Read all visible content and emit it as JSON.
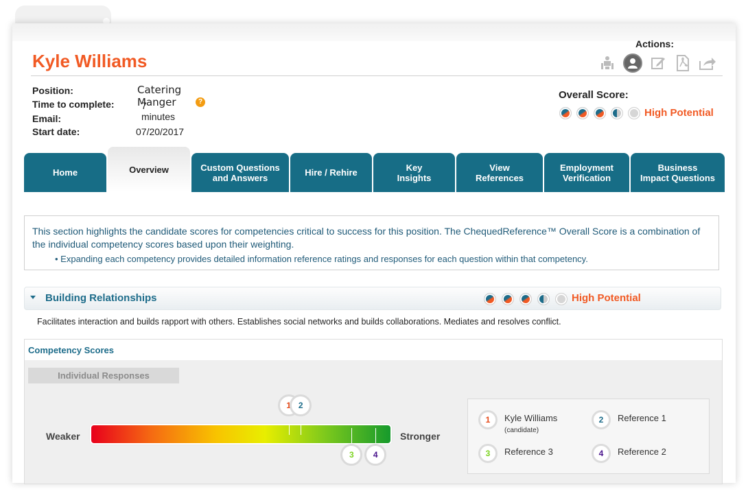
{
  "candidate": {
    "name": "Kyle Williams"
  },
  "actions": {
    "label": "Actions:",
    "icons": [
      "interview-icon",
      "user-profile-icon",
      "edit-icon",
      "pdf-icon",
      "share-icon"
    ]
  },
  "details": {
    "position_label": "Position:",
    "position_value": "Catering Manger",
    "time_label": "Time to complete:",
    "time_value": "7 minutes",
    "help_glyph": "?",
    "email_label": "Email:",
    "email_value": "",
    "start_label": "Start date:",
    "start_value": "07/20/2017"
  },
  "overall": {
    "label": "Overall Score:",
    "rating": "High Potential",
    "score_of_5": 3.5
  },
  "tabs": [
    {
      "line1": "Home",
      "line2": ""
    },
    {
      "line1": "Overview",
      "line2": ""
    },
    {
      "line1": "Custom Questions",
      "line2": "and Answers"
    },
    {
      "line1": "Hire / Rehire",
      "line2": ""
    },
    {
      "line1": "Key",
      "line2": "Insights"
    },
    {
      "line1": "View",
      "line2": "References"
    },
    {
      "line1": "Employment",
      "line2": "Verification"
    },
    {
      "line1": "Business",
      "line2": "Impact Questions"
    }
  ],
  "active_tab": "Overview",
  "intro": {
    "text": "This section highlights the candidate scores for competencies critical to success for this position. The ChequedReference™ Overall Score is a combination of the individual competency scores based upon their weighting.",
    "bullet": "• Expanding each competency provides detailed information reference ratings and responses for each question within that competency."
  },
  "competency": {
    "title": "Building Relationships",
    "rating": "High Potential",
    "score_of_5": 3.5,
    "description": "Facilitates interaction and builds rapport with others. Establishes social networks and builds collaborations. Mediates and resolves conflict."
  },
  "scores": {
    "title": "Competency Scores",
    "individual_responses_label": "Individual Responses",
    "weaker_label": "Weaker",
    "stronger_label": "Stronger",
    "markers": [
      {
        "num": "1",
        "scale_fraction": 0.66
      },
      {
        "num": "2",
        "scale_fraction": 0.7
      },
      {
        "num": "3",
        "scale_fraction": 0.87
      },
      {
        "num": "4",
        "scale_fraction": 0.95
      }
    ],
    "legend": [
      {
        "num": "1",
        "name": "Kyle Williams",
        "sub": "(candidate)"
      },
      {
        "num": "2",
        "name": "Reference 1",
        "sub": ""
      },
      {
        "num": "3",
        "name": "Reference 3",
        "sub": ""
      },
      {
        "num": "4",
        "name": "Reference 2",
        "sub": ""
      }
    ],
    "colors": {
      "1": "#e64a19",
      "2": "#1d6c8a",
      "3": "#7dd321",
      "4": "#4a148c"
    }
  },
  "theme": {
    "accent": "#f15a24",
    "tab_bg": "#176d86"
  }
}
